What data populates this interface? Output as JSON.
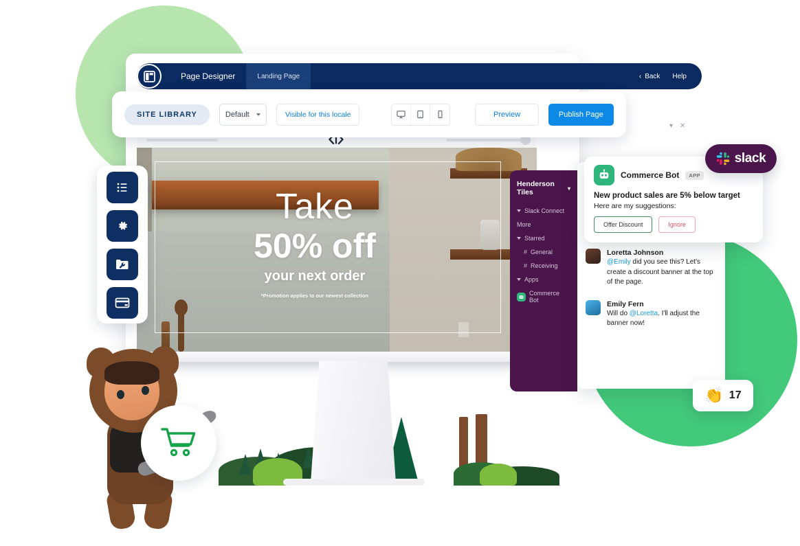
{
  "app": {
    "logo_icon": "page-layout-icon",
    "nav_tabs": [
      {
        "label": "Page Designer",
        "active": true
      },
      {
        "label": "Landing Page",
        "active": false
      }
    ],
    "back_label": "Back",
    "back_icon": "chevron-left-icon",
    "help_label": "Help"
  },
  "toolbar": {
    "site_library_label": "SITE LIBRARY",
    "locale_value": "Default",
    "locale_caret_icon": "chevron-down-icon",
    "visible_locale_label": "Visible for this locale",
    "devices": [
      {
        "name": "desktop",
        "icon": "desktop-icon"
      },
      {
        "name": "tablet",
        "icon": "tablet-icon"
      },
      {
        "name": "mobile",
        "icon": "mobile-icon"
      }
    ],
    "preview_label": "Preview",
    "publish_label": "Publish Page"
  },
  "canvas": {
    "code_icon": "code-embed-icon",
    "mini_caret_icon": "chevron-down-icon",
    "mini_close_icon": "close-icon"
  },
  "rail": {
    "items": [
      {
        "name": "content-list",
        "icon": "list-icon"
      },
      {
        "name": "settings",
        "icon": "gear-icon"
      },
      {
        "name": "tools",
        "icon": "folder-wrench-icon"
      },
      {
        "name": "payments",
        "icon": "credit-card-icon"
      }
    ]
  },
  "banner": {
    "take": "Take",
    "headline": "50% off",
    "subline": "your next order",
    "fine_print": "*Promotion applies to our newest collection"
  },
  "slack": {
    "logo_label": "slack",
    "logo_icon": "slack-hash-icon",
    "workspace": "Henderson Tiles",
    "workspace_caret_icon": "chevron-down-icon",
    "sidebar": [
      {
        "label": "Slack Connect",
        "type": "section"
      },
      {
        "label": "More",
        "type": "plain"
      },
      {
        "label": "Starred",
        "type": "section"
      },
      {
        "label": "General",
        "type": "channel"
      },
      {
        "label": "Receiving",
        "type": "channel"
      },
      {
        "label": "Apps",
        "type": "section"
      },
      {
        "label": "Commerce Bot",
        "type": "app"
      }
    ],
    "bot": {
      "name": "Commerce Bot",
      "tag": "APP",
      "avatar_icon": "robot-icon",
      "alert": "New product sales are 5% below target",
      "subtitle": "Here are my suggestions:",
      "primary_action": "Offer Discount",
      "secondary_action": "Ignore"
    },
    "messages": [
      {
        "author": "Loretta Johnson",
        "avatar": "avatar-loretta",
        "mention": "@Emily",
        "text": " did you see this? Let's create a discount banner at the top of the page."
      },
      {
        "author": "Emily Fern",
        "avatar": "avatar-emily",
        "prefix": "Will do ",
        "mention": "@Loretta",
        "text": ". I'll adjust the banner now!"
      }
    ],
    "reaction": {
      "emoji_icon": "clap-emoji",
      "count": "17"
    }
  },
  "character": {
    "name": "astro-mascot",
    "badge_icon": "shopping-cart-icon"
  },
  "colors": {
    "navy": "#0a2a60",
    "blue": "#0d8ae8",
    "slack_purple": "#4a154b",
    "slack_green": "#2eb67d",
    "green_bright": "#42c97a",
    "green_light": "#b6e6ae"
  }
}
